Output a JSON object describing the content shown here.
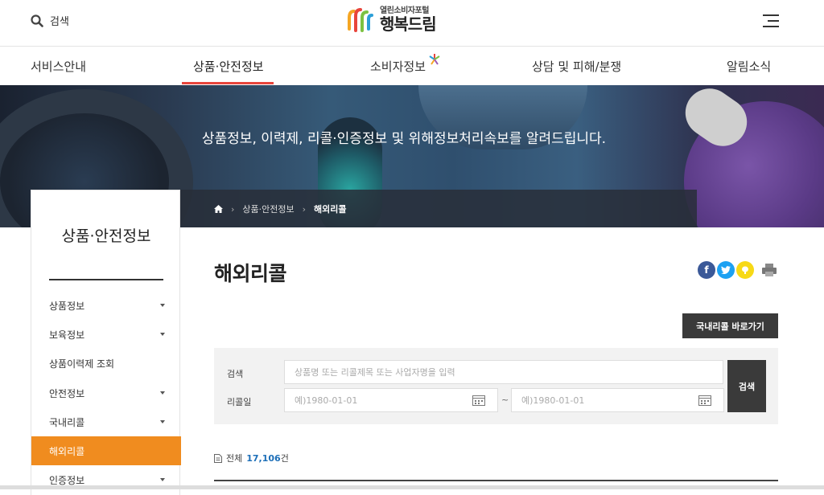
{
  "header": {
    "search_label": "검색",
    "logo_sub": "열린소비자포털",
    "logo_main": "행복드림"
  },
  "gnb": {
    "items": [
      {
        "label": "서비스안내"
      },
      {
        "label": "상품·안전정보"
      },
      {
        "label": "소비자정보"
      },
      {
        "label": "상담 및 피해/분쟁"
      },
      {
        "label": "알림소식"
      }
    ],
    "active_index": 1
  },
  "hero": {
    "slogan": "상품정보, 이력제, 리콜·인증정보 및 위해정보처리속보를 알려드립니다."
  },
  "breadcrumb": {
    "items": [
      "상품·안전정보",
      "해외리콜"
    ]
  },
  "lnb": {
    "title": "상품·안전정보",
    "items": [
      {
        "label": "상품정보",
        "has_sub": true
      },
      {
        "label": "보육정보",
        "has_sub": true
      },
      {
        "label": "상품이력제 조회",
        "has_sub": false
      },
      {
        "label": "안전정보",
        "has_sub": true
      },
      {
        "label": "국내리콜",
        "has_sub": true
      },
      {
        "label": "해외리콜",
        "has_sub": false,
        "active": true
      },
      {
        "label": "인증정보",
        "has_sub": true
      }
    ]
  },
  "main": {
    "title": "해외리콜",
    "domestic_button": "국내리콜 바로가기",
    "search": {
      "keyword_label": "검색",
      "keyword_placeholder": "상품명 또는 리콜제목 또는 사업자명을 입력",
      "date_label": "리콜일",
      "date_from_placeholder": "예)1980-01-01",
      "date_sep": "~",
      "date_to_placeholder": "예)1980-01-01",
      "submit_label": "검색"
    },
    "total": {
      "prefix": "전체",
      "count": "17,106",
      "suffix": "건"
    }
  },
  "colors": {
    "accent_orange": "#f08c1f",
    "active_underline": "#e8453c",
    "facebook": "#3b5998",
    "twitter": "#1da1f2",
    "kakao": "#f7d916",
    "count_blue": "#1d6fb8"
  }
}
